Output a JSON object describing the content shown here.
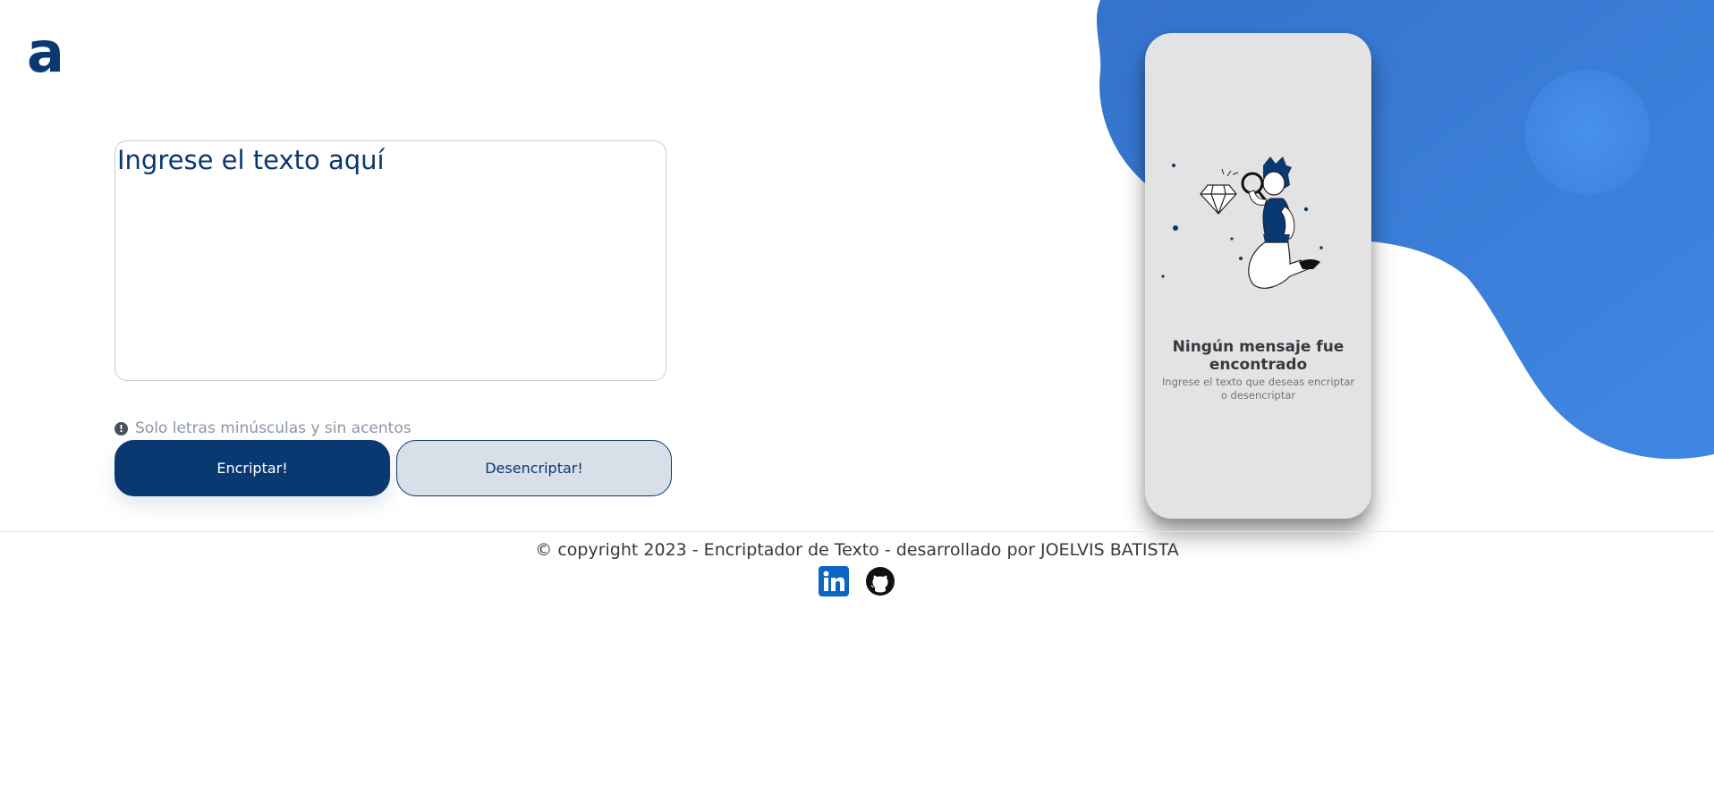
{
  "brand": {
    "logo_text": "a",
    "color": "#0a3871"
  },
  "editor": {
    "placeholder": "Ingrese el texto aquí",
    "value": ""
  },
  "hint": {
    "icon": "exclamation-circle-icon",
    "text": "Solo letras minúsculas y sin acentos"
  },
  "actions": {
    "encrypt_label": "Encriptar!",
    "decrypt_label": "Desencriptar!"
  },
  "output_panel": {
    "illustration": "person-with-magnifier-and-diamond",
    "title": "Ningún mensaje fue encontrado",
    "subtitle": "Ingrese el texto que deseas encriptar o desencriptar"
  },
  "footer": {
    "copyright": "© copyright 2023 - Encriptador de Texto - desarrollado por JOELVIS BATISTA",
    "social": [
      {
        "icon": "linkedin-icon"
      },
      {
        "icon": "github-icon"
      }
    ]
  },
  "colors": {
    "primary": "#0a3871",
    "secondary_bg": "#d8dfe8",
    "blob": "#3a7bd5",
    "panel_bg": "#e3e3e3"
  }
}
